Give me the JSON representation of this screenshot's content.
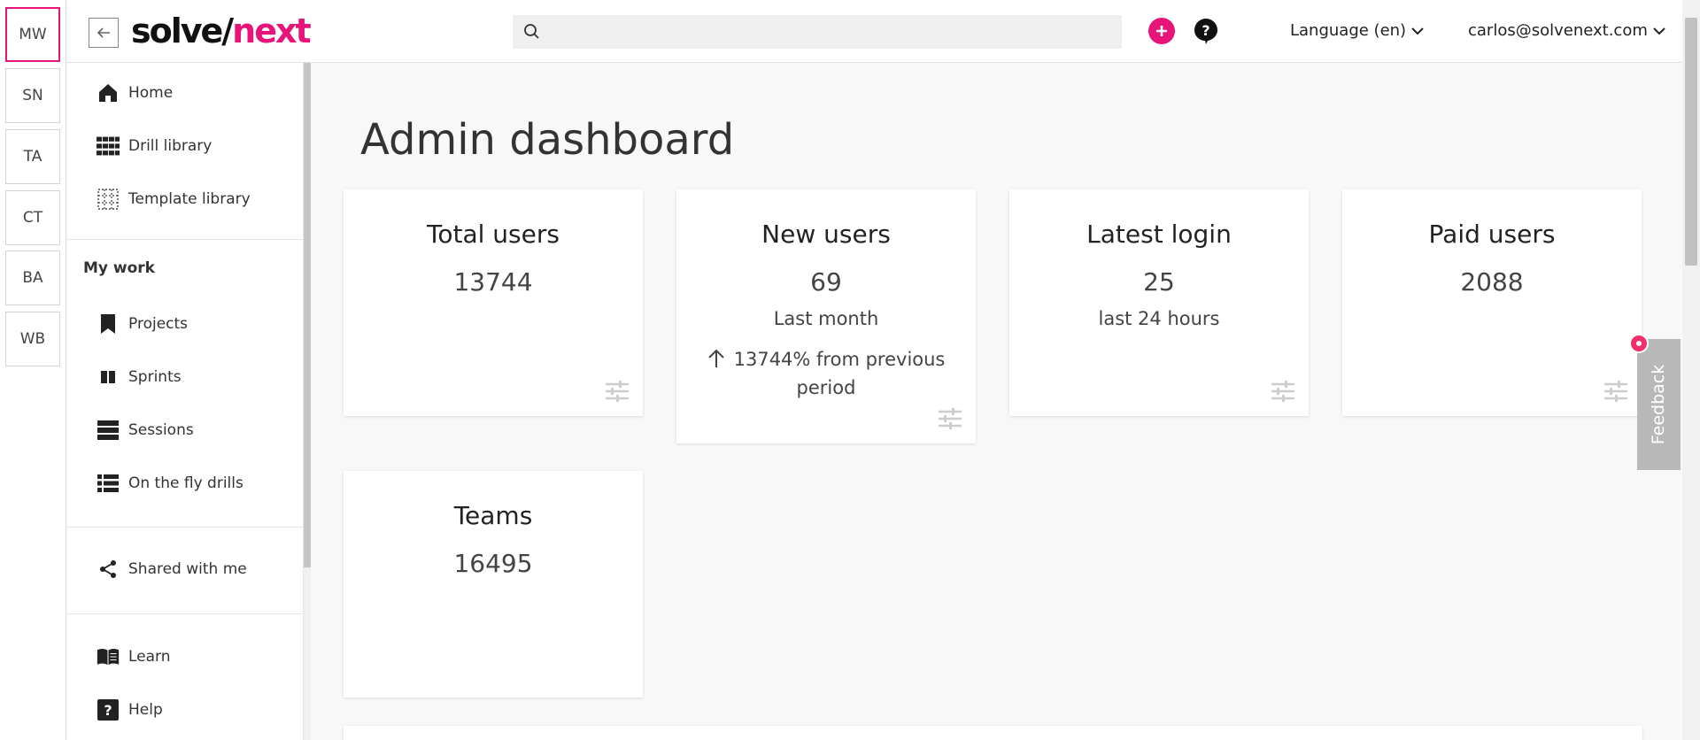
{
  "workspaces": [
    {
      "code": "MW",
      "active": true
    },
    {
      "code": "SN",
      "active": false
    },
    {
      "code": "TA",
      "active": false
    },
    {
      "code": "CT",
      "active": false
    },
    {
      "code": "BA",
      "active": false
    },
    {
      "code": "WB",
      "active": false
    }
  ],
  "header": {
    "logo_part1": "solve/",
    "logo_part2": "next",
    "search_placeholder": "",
    "language_label": "Language (en)",
    "account_email": "carlos@solvenext.com"
  },
  "sidebar": {
    "items_top": [
      {
        "label": "Home",
        "icon": "home-icon"
      },
      {
        "label": "Drill library",
        "icon": "grid-icon"
      },
      {
        "label": "Template library",
        "icon": "dotted-grid-icon"
      }
    ],
    "my_work_heading": "My work",
    "items_work": [
      {
        "label": "Projects",
        "icon": "bookmark-icon"
      },
      {
        "label": "Sprints",
        "icon": "columns-icon"
      },
      {
        "label": "Sessions",
        "icon": "stack-icon"
      },
      {
        "label": "On the fly drills",
        "icon": "list-icon"
      }
    ],
    "shared_label": "Shared with me",
    "learn_label": "Learn",
    "help_label": "Help"
  },
  "page": {
    "title": "Admin dashboard"
  },
  "stats": {
    "total_users": {
      "title": "Total users",
      "value": "13744"
    },
    "new_users": {
      "title": "New users",
      "value": "69",
      "sub": "Last month",
      "delta": "13744% from previous period"
    },
    "latest_login": {
      "title": "Latest login",
      "value": "25",
      "sub": "last 24 hours"
    },
    "paid_users": {
      "title": "Paid users",
      "value": "2088"
    },
    "teams": {
      "title": "Teams",
      "value": "16495"
    }
  },
  "feedback_label": "Feedback",
  "colors": {
    "accent": "#e7157a",
    "feedback_bg": "#b8b8b8"
  }
}
